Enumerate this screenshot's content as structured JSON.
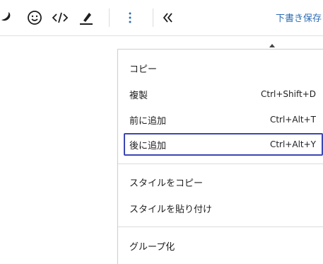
{
  "toolbar": {
    "icons": [
      "wp-logo-icon",
      "emoji-icon",
      "code-icon",
      "highlighter-icon",
      "more-vertical-icon",
      "collapse-left-icon"
    ],
    "save_draft_label": "下書き保存"
  },
  "context_menu": {
    "groups": [
      [
        {
          "label": "コピー",
          "shortcut": ""
        },
        {
          "label": "複製",
          "shortcut": "Ctrl+Shift+D"
        },
        {
          "label": "前に追加",
          "shortcut": "Ctrl+Alt+T"
        },
        {
          "label": "後に追加",
          "shortcut": "Ctrl+Alt+Y"
        }
      ],
      [
        {
          "label": "スタイルをコピー",
          "shortcut": ""
        },
        {
          "label": "スタイルを貼り付け",
          "shortcut": ""
        }
      ],
      [
        {
          "label": "グループ化",
          "shortcut": ""
        }
      ]
    ],
    "focused_item": "後に追加",
    "focus_color": "#3a47b5"
  },
  "accent_link_color": "#2c6bb2"
}
